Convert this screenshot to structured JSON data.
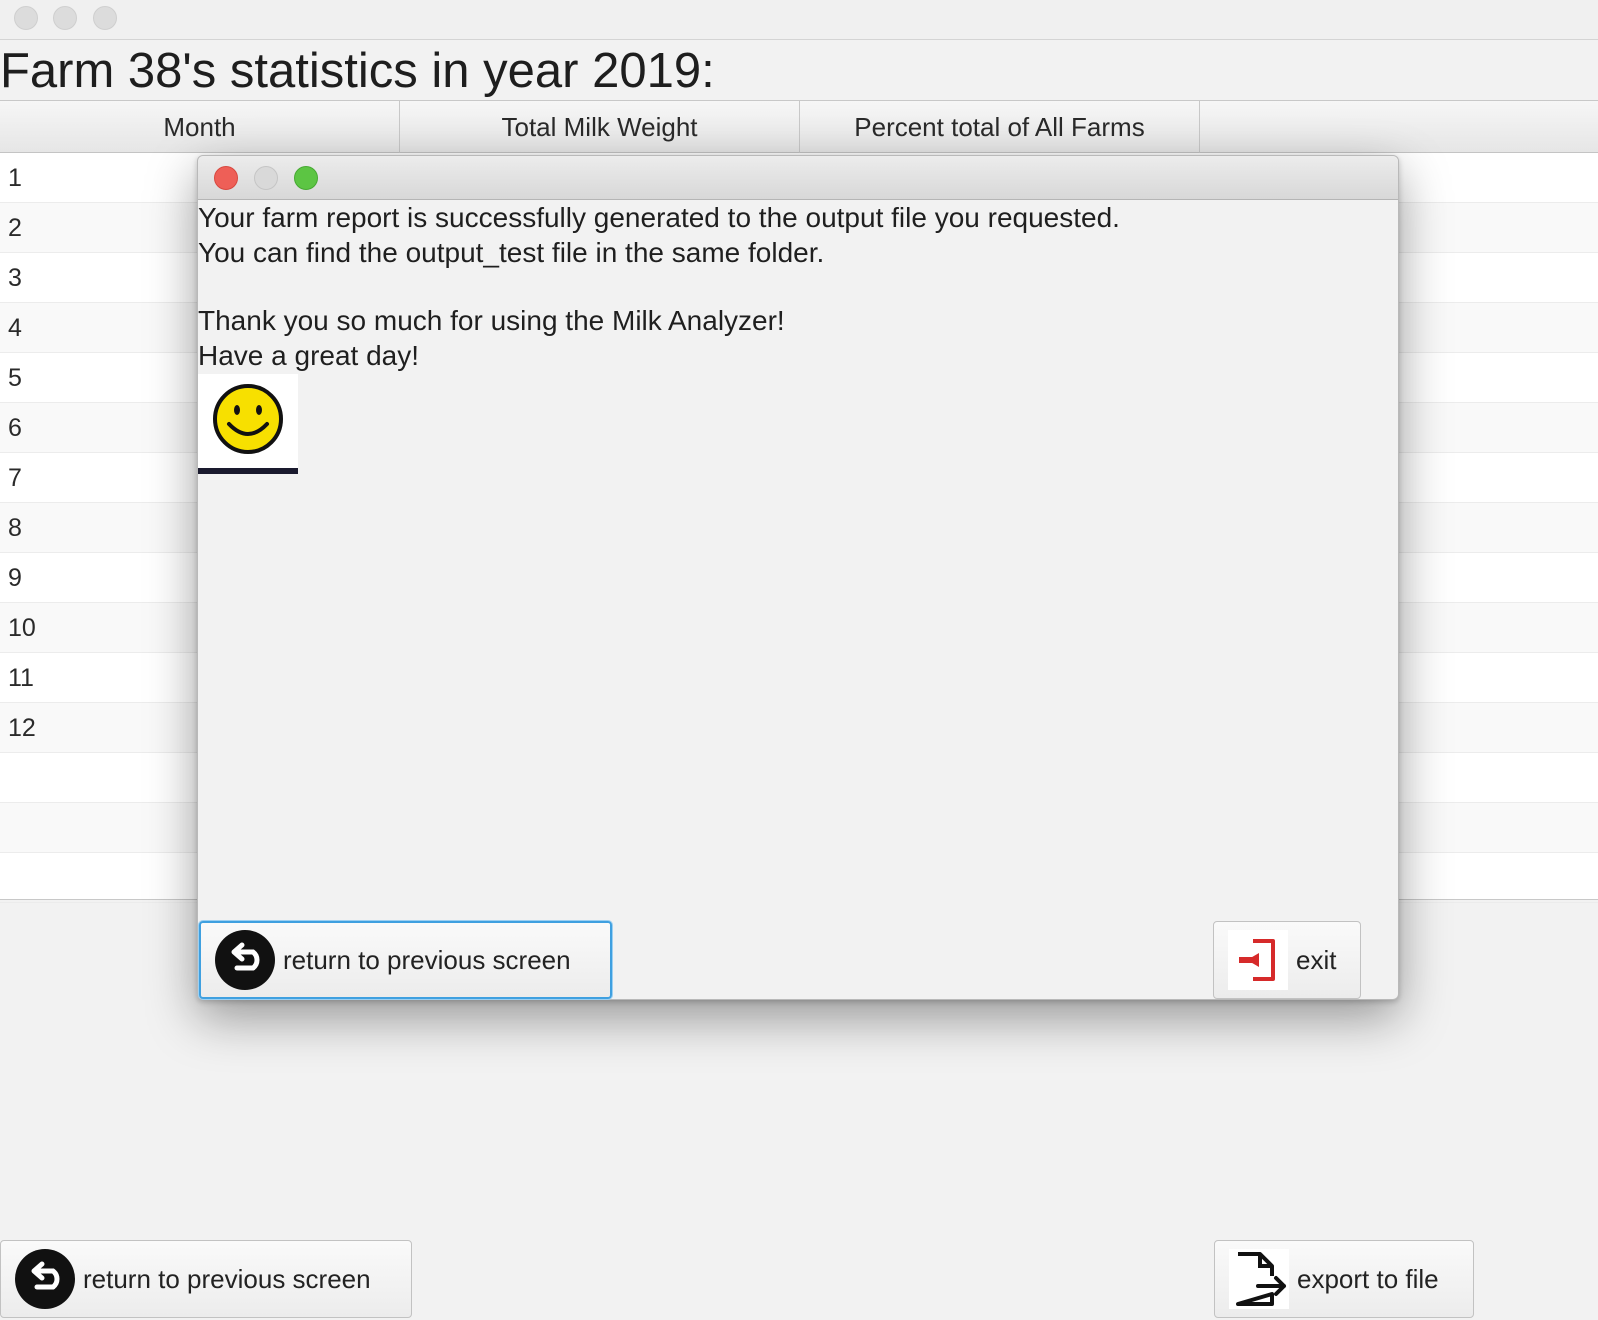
{
  "window": {
    "title_text": "Farm 38's statistics in year 2019:"
  },
  "table": {
    "columns": [
      "Month",
      "Total Milk Weight",
      "Percent total of All Farms",
      ""
    ],
    "rows": [
      "1",
      "2",
      "3",
      "4",
      "5",
      "6",
      "7",
      "8",
      "9",
      "10",
      "11",
      "12"
    ]
  },
  "main_buttons": {
    "return_label": "return to previous screen",
    "export_label": "export to file"
  },
  "dialog": {
    "line1": "Your farm report is successfully generated to the output file you requested.",
    "line2": "You can find the output_test file in the same folder.",
    "line3": "Thank you so much for using the Milk Analyzer!",
    "line4": "Have a great day!",
    "return_label": "return to previous screen",
    "exit_label": "exit"
  },
  "colors": {
    "close": "#ee5f57",
    "minimize": "#d9d9d9",
    "zoom": "#5cc543",
    "focus": "#3fa0e0",
    "exit_red": "#d62a2a",
    "smiley": "#f7e000"
  },
  "icons": [
    "back-arrow-icon",
    "export-file-icon",
    "exit-door-icon",
    "smiley-icon"
  ]
}
